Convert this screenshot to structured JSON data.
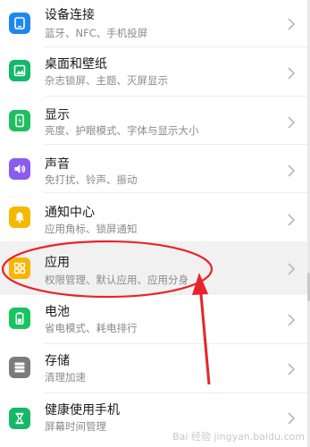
{
  "settings_list": [
    {
      "title": "设备连接",
      "subtitle": "蓝牙、NFC、手机投屏",
      "icon": "device-connection-icon",
      "color": "#1e88f0"
    },
    {
      "title": "桌面和壁纸",
      "subtitle": "杂志锁屏、主题、灭屏显示",
      "icon": "wallpaper-icon",
      "color": "#14b86a"
    },
    {
      "title": "显示",
      "subtitle": "亮度、护眼模式、字体与显示大小",
      "icon": "display-icon",
      "color": "#1fbf60"
    },
    {
      "title": "声音",
      "subtitle": "免打扰、铃声、振动",
      "icon": "speaker-icon",
      "color": "#8a5cf0"
    },
    {
      "title": "通知中心",
      "subtitle": "应用角标、锁屏通知",
      "icon": "bell-icon",
      "color": "#f5b800"
    },
    {
      "title": "应用",
      "subtitle": "权限管理、默认应用、应用分身",
      "icon": "apps-grid-icon",
      "color": "#f7b500",
      "selected": true
    },
    {
      "title": "电池",
      "subtitle": "省电模式、耗电排行",
      "icon": "battery-icon",
      "color": "#18c460"
    },
    {
      "title": "存储",
      "subtitle": "清理加速",
      "icon": "storage-icon",
      "color": "#7c7c7c"
    },
    {
      "title": "健康使用手机",
      "subtitle": "屏幕时间管理",
      "icon": "hourglass-icon",
      "color": "#16b867"
    }
  ],
  "annotation": {
    "color": "#e8242a"
  },
  "watermark": "Bai 经验 jingyan.baidu.com"
}
